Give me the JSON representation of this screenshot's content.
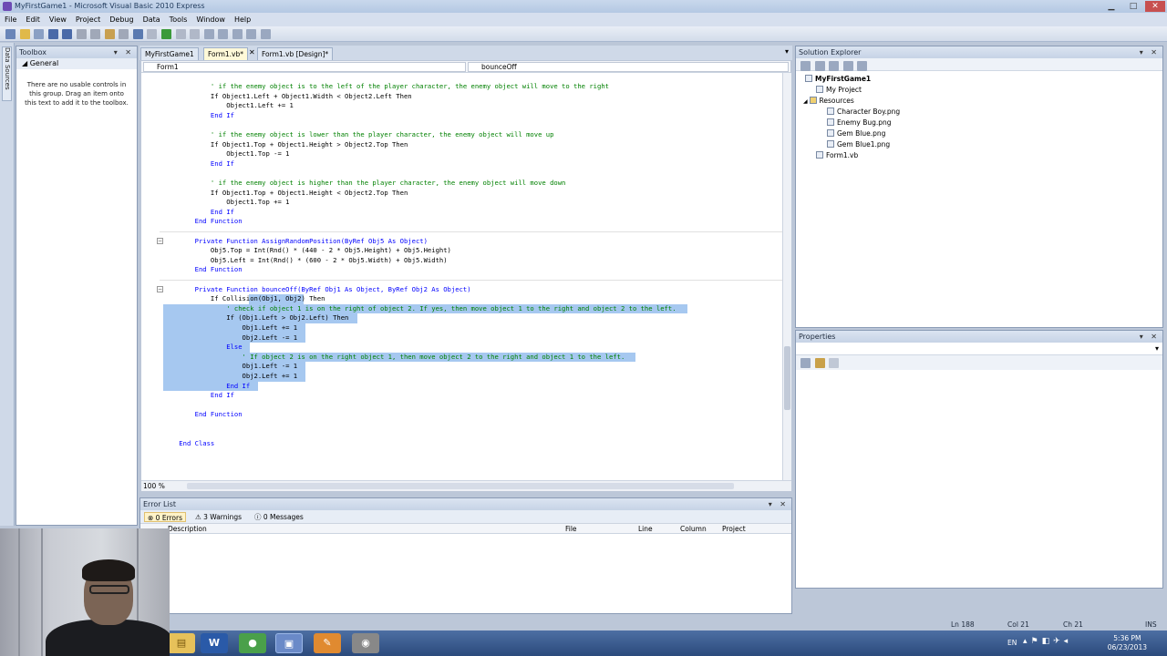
{
  "window": {
    "title": "MyFirstGame1 - Microsoft Visual Basic 2010 Express"
  },
  "menu": [
    "File",
    "Edit",
    "View",
    "Project",
    "Debug",
    "Data",
    "Tools",
    "Window",
    "Help"
  ],
  "left_strip": {
    "data_sources": "Data Sources"
  },
  "toolbox": {
    "title": "Toolbox",
    "group": "◢ General",
    "message": "There are no usable controls in this group. Drag an item onto this text to add it to the toolbox."
  },
  "tabs": [
    {
      "label": "MyFirstGame1"
    },
    {
      "label": "Form1.vb*"
    },
    {
      "label": "Form1.vb [Design]*"
    }
  ],
  "nav": {
    "object": "Form1",
    "member": "bounceOff"
  },
  "code_lines": [
    "            ' if the enemy object is to the left of the player character, the enemy object will move to the right",
    "            If Object1.Left + Object1.Width < Object2.Left Then",
    "                Object1.Left += 1",
    "            End If",
    "",
    "            ' if the enemy object is lower than the player character, the enemy object will move up",
    "            If Object1.Top + Object1.Height > Object2.Top Then",
    "                Object1.Top -= 1",
    "            End If",
    "",
    "            ' if the enemy object is higher than the player character, the enemy object will move down",
    "            If Object1.Top + Object1.Height < Object2.Top Then",
    "                Object1.Top += 1",
    "            End If",
    "        End Function",
    "",
    "        Private Function AssignRandomPosition(ByRef Obj5 As Object)",
    "            Obj5.Top = Int(Rnd() * (440 - 2 * Obj5.Height) + Obj5.Height)",
    "            Obj5.Left = Int(Rnd() * (600 - 2 * Obj5.Width) + Obj5.Width)",
    "        End Function",
    "",
    "        Private Function bounceOff(ByRef Obj1 As Object, ByRef Obj2 As Object)",
    "            If Collision(Obj1, Obj2) Then",
    "                ' check if object 1 is on the right of object 2. If yes, then move object 1 to the right and object 2 to the left.",
    "                If (Obj1.Left > Obj2.Left) Then",
    "                    Obj1.Left += 1",
    "                    Obj2.Left -= 1",
    "                Else",
    "                    ' If object 2 is on the right object 1, then move object 2 to the right and object 1 to the left.",
    "                    Obj1.Left -= 1",
    "                    Obj2.Left += 1",
    "                End If",
    "            End If",
    "",
    "        End Function",
    "",
    "",
    "    End Class"
  ],
  "zoom": "100 %",
  "error_list": {
    "title": "Error List",
    "errors": "0 Errors",
    "warnings": "3 Warnings",
    "messages": "0 Messages",
    "columns": [
      "Description",
      "File",
      "Line",
      "Column",
      "Project"
    ]
  },
  "solution_explorer": {
    "title": "Solution Explorer",
    "project": "MyFirstGame1",
    "my_project": "My Project",
    "resources": "Resources",
    "files": [
      "Character Boy.png",
      "Enemy Bug.png",
      "Gem Blue.png",
      "Gem Blue1.png"
    ],
    "form": "Form1.vb"
  },
  "properties": {
    "title": "Properties"
  },
  "status": {
    "ln": "Ln 188",
    "col": "Col 21",
    "ch": "Ch 21",
    "ins": "INS"
  },
  "taskbar": {
    "lang": "EN",
    "time": "5:36 PM",
    "date": "06/23/2013"
  },
  "colors": {
    "keyword": "#0000ff",
    "comment": "#008000",
    "selection": "#a6c8f0"
  }
}
